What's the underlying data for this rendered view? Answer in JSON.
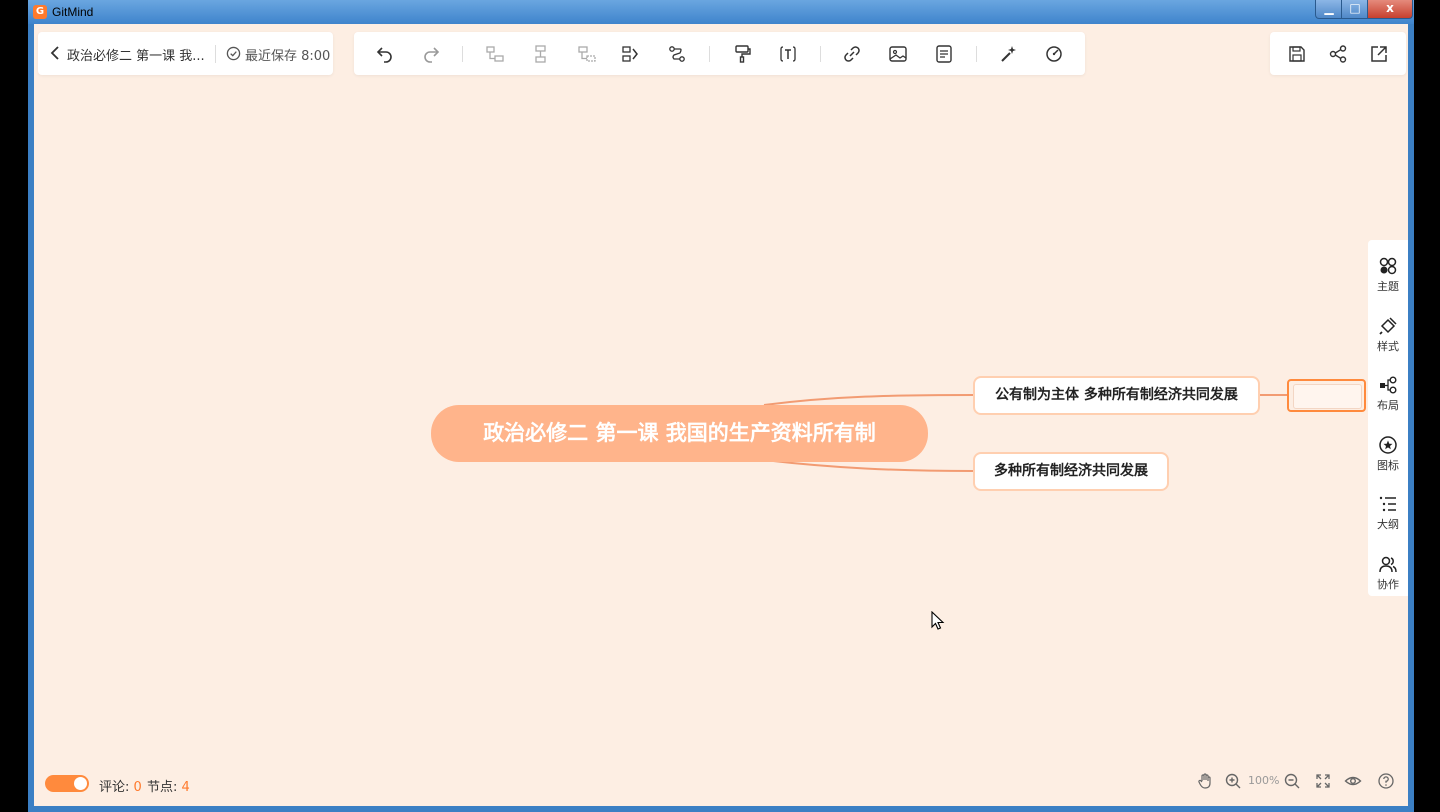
{
  "window": {
    "app_title": "GitMind",
    "controls": {
      "minimize": "▁",
      "maximize": "□",
      "close": "x"
    }
  },
  "header": {
    "doc_title": "政治必修二 第一课 我...",
    "save_status": "最近保存 8:00"
  },
  "mindmap": {
    "root": "政治必修二 第一课 我国的生产资料所有制",
    "children": [
      "公有制为主体 多种所有制经济共同发展",
      "多种所有制经济共同发展"
    ],
    "new_node_value": ""
  },
  "sidebar": {
    "items": [
      {
        "label": "主题",
        "icon": "theme-icon"
      },
      {
        "label": "样式",
        "icon": "style-icon"
      },
      {
        "label": "布局",
        "icon": "layout-icon"
      },
      {
        "label": "图标",
        "icon": "icon-icon"
      },
      {
        "label": "大纲",
        "icon": "outline-icon"
      },
      {
        "label": "协作",
        "icon": "collaborate-icon"
      }
    ]
  },
  "footer": {
    "comments_label": "评论:",
    "comments_count": "0",
    "nodes_label": "节点:",
    "nodes_count": "4",
    "zoom": "100%"
  },
  "colors": {
    "canvas": "#fdeee3",
    "root_fill": "#ffb48b",
    "accent": "#ff7a2d",
    "branch": "#f29b72"
  }
}
